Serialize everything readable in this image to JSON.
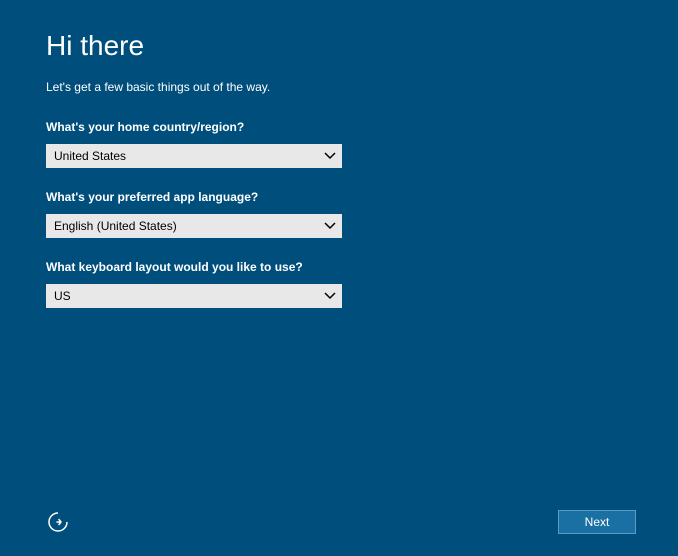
{
  "header": {
    "title": "Hi there",
    "subtitle": "Let's get a few basic things out of the way."
  },
  "fields": {
    "country": {
      "label": "What's your home country/region?",
      "value": "United States"
    },
    "language": {
      "label": "What's your preferred app language?",
      "value": "English (United States)"
    },
    "keyboard": {
      "label": "What keyboard layout would you like to use?",
      "value": "US"
    }
  },
  "footer": {
    "next_label": "Next"
  }
}
